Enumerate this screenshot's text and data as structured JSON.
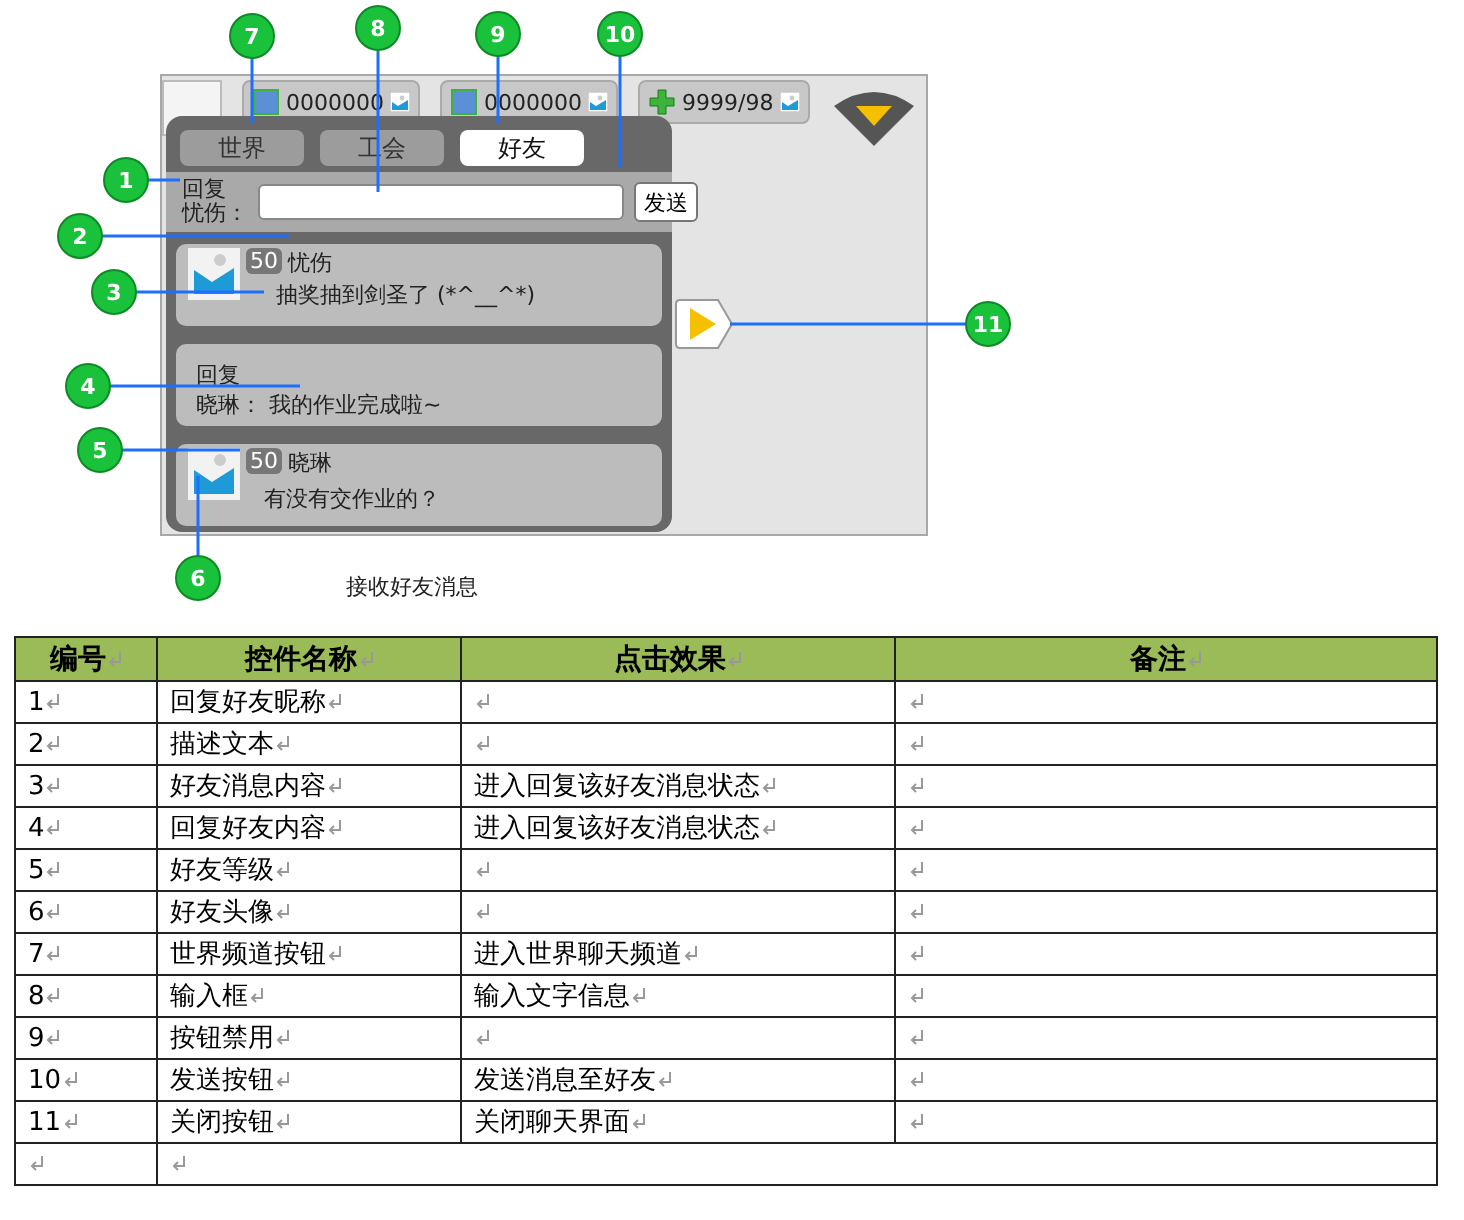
{
  "figure": {
    "counters": [
      {
        "value": "0000000"
      },
      {
        "value": "0000000"
      },
      {
        "value": "9999/98"
      }
    ],
    "tabs": [
      {
        "label": "世界",
        "selected": false
      },
      {
        "label": "工会",
        "selected": false
      },
      {
        "label": "好友",
        "selected": true
      }
    ],
    "reply": {
      "label": [
        "回复",
        "忧伤："
      ],
      "send": "发送"
    },
    "messages": [
      {
        "kind": "friend",
        "badge": "50",
        "name": "忧伤",
        "text": "抽奖抽到剑圣了 (*^__^*)"
      },
      {
        "kind": "reply",
        "title": "回复",
        "text": "晓琳：  我的作业完成啦~"
      },
      {
        "kind": "friend",
        "badge": "50",
        "name": "晓琳",
        "text": "有没有交作业的？"
      }
    ],
    "callouts": [
      "1",
      "2",
      "3",
      "4",
      "5",
      "6",
      "7",
      "8",
      "9",
      "10",
      "11"
    ],
    "caption": "接收好友消息"
  },
  "table": {
    "columns": [
      "编号",
      "控件名称",
      "点击效果",
      "备注"
    ],
    "rows": [
      {
        "number": "1",
        "name": "回复好友昵称"
      },
      {
        "number": "2",
        "name": "描述文本"
      },
      {
        "number": "3",
        "name": "好友消息内容",
        "effect": "进入回复该好友消息状态"
      },
      {
        "number": "4",
        "name": "回复好友内容",
        "effect": "进入回复该好友消息状态"
      },
      {
        "number": "5",
        "name": "好友等级"
      },
      {
        "number": "6",
        "name": "好友头像"
      },
      {
        "number": "7",
        "name": "世界频道按钮",
        "effect": "进入世界聊天频道"
      },
      {
        "number": "8",
        "name": "输入框",
        "effect": "输入文字信息"
      },
      {
        "number": "9",
        "name": "按钮禁用"
      },
      {
        "number": "10",
        "name": "发送按钮",
        "effect": "发送消息至好友"
      },
      {
        "number": "11",
        "name": "关闭按钮",
        "effect": "关闭聊天界面"
      }
    ]
  }
}
